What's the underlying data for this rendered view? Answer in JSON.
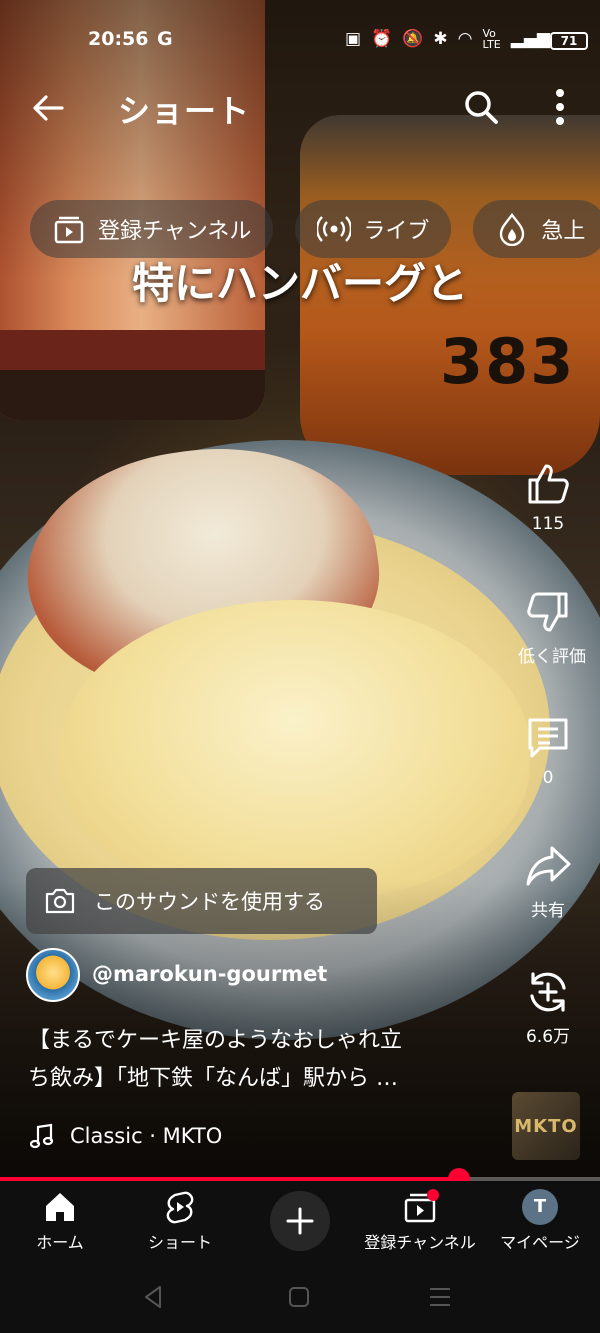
{
  "status_bar": {
    "time": "20:56",
    "g_icon": "G",
    "battery": "71",
    "icons": [
      "nfc-icon",
      "alarm-icon",
      "mute-icon",
      "bluetooth-icon",
      "wifi-icon",
      "volte-icon",
      "signal-icon"
    ]
  },
  "header": {
    "title": "ショート"
  },
  "chips": [
    {
      "label": "登録チャンネル",
      "icon": "subscriptions-icon"
    },
    {
      "label": "ライブ",
      "icon": "live-icon"
    },
    {
      "label": "急上",
      "icon": "trending-icon"
    }
  ],
  "video": {
    "caption": "特にハンバーグと",
    "glass_number": "383"
  },
  "actions": {
    "like_count": "115",
    "dislike_label": "低く評価",
    "comment_count": "0",
    "share_label": "共有",
    "remix_count": "6.6万"
  },
  "sound_button": {
    "label": "このサウンドを使用する"
  },
  "channel": {
    "handle": "@marokun-gourmet"
  },
  "description": {
    "line1": "【まるでケーキ屋のようなおしゃれ立",
    "line2": "ち飲み】「地下鉄「なんば」駅から …"
  },
  "music": {
    "label": "Classic · MKTO",
    "album_text": "MKTO"
  },
  "progress": {
    "fraction": 0.765
  },
  "bottom_nav": {
    "home": "ホーム",
    "shorts": "ショート",
    "subscriptions": "登録チャンネル",
    "mypage": "マイページ",
    "profile_initial": "T"
  },
  "colors": {
    "accent": "#ff0033",
    "nav_bg": "#0f0f0f"
  }
}
